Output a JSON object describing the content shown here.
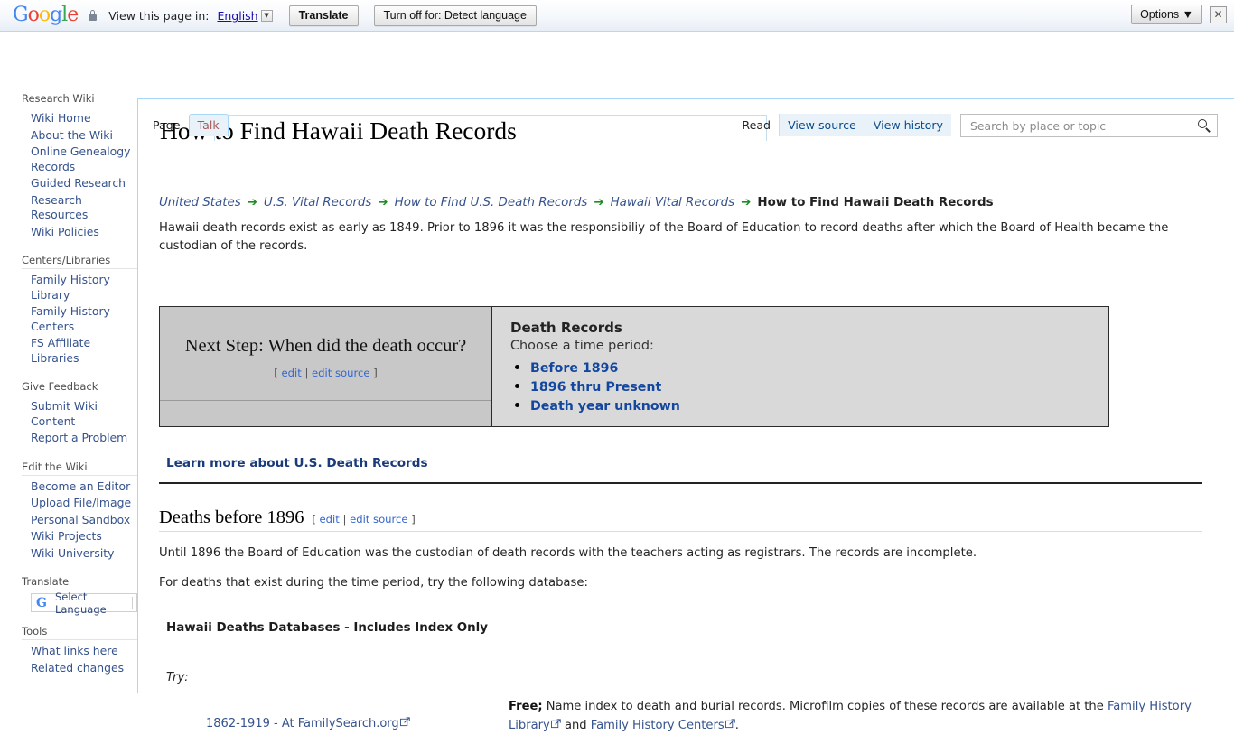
{
  "translate_bar": {
    "logo": "Google",
    "lock_icon": "lock-icon",
    "view_label": "View this page in:",
    "language": "English",
    "dropdown_icon": "chevron-down-icon",
    "translate_button": "Translate",
    "turnoff_button": "Turn off for: Detect language",
    "options_button": "Options ▼",
    "close_icon": "✕"
  },
  "sidebar": {
    "sections": [
      {
        "heading": "Research Wiki",
        "items": [
          "Wiki Home",
          "About the Wiki",
          "Online Genealogy Records",
          "Guided Research",
          "Research Resources",
          "Wiki Policies"
        ]
      },
      {
        "heading": "Centers/Libraries",
        "items": [
          "Family History Library",
          "Family History Centers",
          "FS Affiliate Libraries"
        ]
      },
      {
        "heading": "Give Feedback",
        "items": [
          "Submit Wiki Content",
          "Report a Problem"
        ]
      },
      {
        "heading": "Edit the Wiki",
        "items": [
          "Become an Editor",
          "Upload File/Image",
          "Personal Sandbox",
          "Wiki Projects",
          "Wiki University"
        ]
      },
      {
        "heading": "Translate",
        "items": []
      },
      {
        "heading": "Tools",
        "items": [
          "What links here",
          "Related changes"
        ]
      }
    ],
    "select_language": "Select Language",
    "google_g": "G"
  },
  "header": {
    "title": "How to Find Hawaii Death Records",
    "tabs_left": [
      {
        "label": "Page",
        "selected": false
      },
      {
        "label": "Talk",
        "selected": true
      }
    ],
    "tabs_right": [
      {
        "label": "Read"
      },
      {
        "label": "View source"
      },
      {
        "label": "View history"
      }
    ],
    "search_placeholder": "Search by place or topic",
    "search_value": "",
    "search_icon": "search-icon"
  },
  "breadcrumb": {
    "separator": "➔",
    "items": [
      "United States",
      "U.S. Vital Records",
      "How to Find U.S. Death Records",
      "Hawaii Vital Records"
    ],
    "current": "How to Find Hawaii Death Records"
  },
  "main": {
    "intro": "Hawaii death records exist as early as 1849. Prior to 1896 it was the responsibiliy of the Board of Education to record deaths after which the Board of Health became the custodian of the records.",
    "next_step": {
      "title": "Next Step: When did the death occur?",
      "edit_open": "[",
      "edit": "edit",
      "edit_pipe": "|",
      "edit_source": "edit source",
      "edit_close": "]"
    },
    "death_records": {
      "heading": "Death Records",
      "subheading": "Choose a time period:",
      "links": [
        "Before 1896",
        "1896 thru Present",
        "Death year unknown"
      ]
    },
    "learn_more": "Learn more about U.S. Death Records",
    "section": {
      "heading": "Deaths before 1896",
      "edit_open": "[",
      "edit": "edit",
      "edit_pipe": "|",
      "edit_source": "edit source",
      "edit_close": "]",
      "paragraph_1": "Until 1896 the Board of Education was the custodian of death records with the teachers acting as registrars. The records are incomplete.",
      "paragraph_2": "For deaths that exist during the time period, try the following database:",
      "subhead": "Hawaii Deaths Databases - Includes Index Only",
      "try_label": "Try:"
    },
    "database": {
      "link": "1862-1919 - At FamilySearch.org",
      "free_label": "Free;",
      "description": " Name index to death and burial records. Microfilm copies of these records are available at the ",
      "fhl_link": "Family History Library",
      "and_text": " and ",
      "fhc_link": "Family History Centers",
      "period": "."
    }
  },
  "colors": {
    "link": "#36538d",
    "bold_link": "#13479f",
    "accent_blue": "#a7d7f9",
    "box_gray": "#d4d4d4",
    "arrow_green": "#1f8b24"
  }
}
